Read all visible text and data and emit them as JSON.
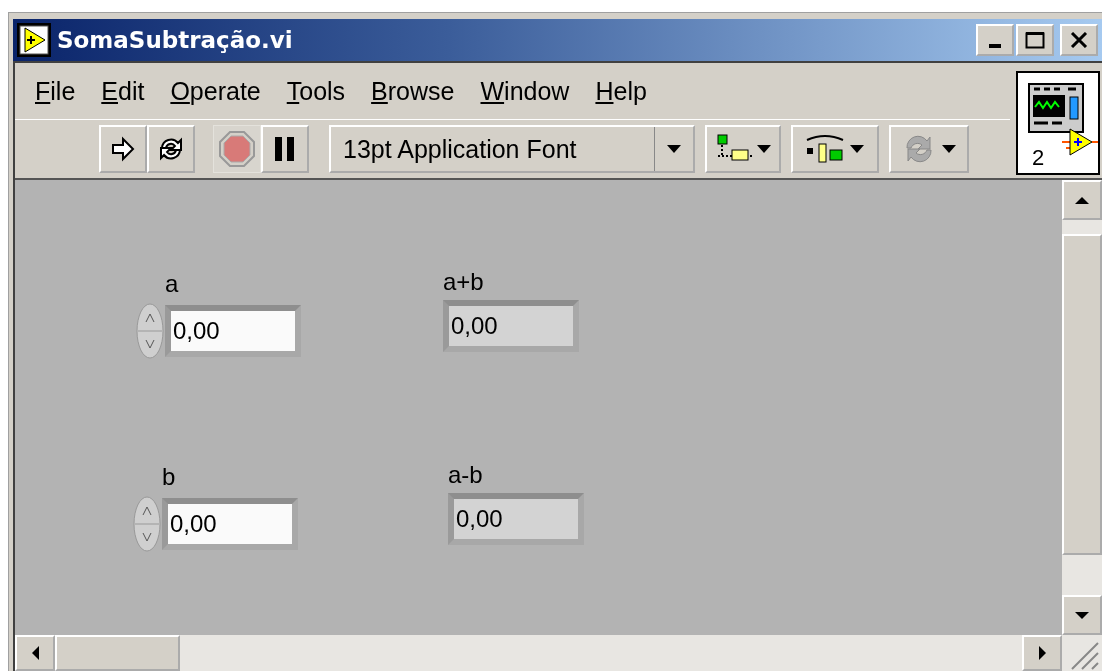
{
  "window": {
    "title": "SomaSubtração.vi"
  },
  "menu": [
    "File",
    "Edit",
    "Operate",
    "Tools",
    "Browse",
    "Window",
    "Help"
  ],
  "toolbar": {
    "font_dropdown": "13pt Application Font"
  },
  "connector_pane": {
    "label": "2"
  },
  "front_panel": {
    "items": [
      {
        "kind": "control",
        "label": "a",
        "value": "0,00"
      },
      {
        "kind": "indicator",
        "label": "a+b",
        "value": "0,00"
      },
      {
        "kind": "control",
        "label": "b",
        "value": "0,00"
      },
      {
        "kind": "indicator",
        "label": "a-b",
        "value": "0,00"
      }
    ]
  }
}
